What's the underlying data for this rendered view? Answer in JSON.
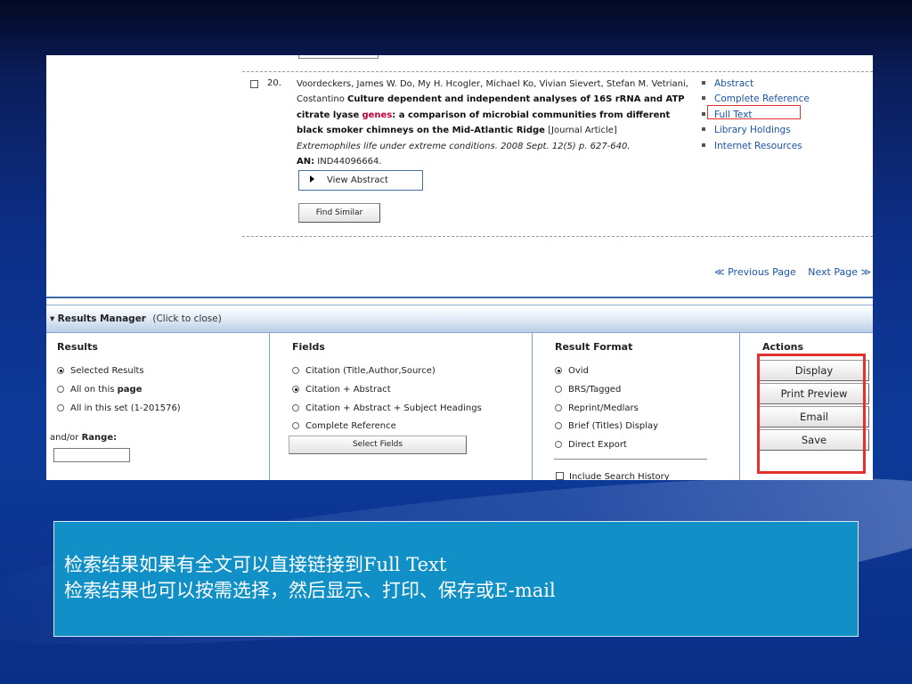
{
  "record": {
    "number": "20.",
    "authors": "Voordeckers, James W. Do, My H. Hcogler, Michael Ko, Vivian Sievert, Stefan M. Vetriani, Costantino",
    "title_part1": "Culture dependent and independent analyses of 16S rRNA and ATP citrate lyase",
    "title_highlight": "genes",
    "title_part2": ": a comparison of microbial communities from different black smoker chimneys on the Mid-Atlantic Ridge",
    "doc_type": "[Journal Article]",
    "source": "Extremophiles life under extreme conditions. 2008 Sept. 12(5) p. 627-640.",
    "an_label": "AN:",
    "an_value": "IND44096664.",
    "view_abstract_label": "View Abstract",
    "find_similar_label": "Find Similar",
    "links": [
      "Abstract",
      "Complete Reference",
      "Full Text",
      "Library Holdings",
      "Internet Resources"
    ]
  },
  "pager": {
    "previous": "≪ Previous Page",
    "next": "Next Page ≫"
  },
  "results_manager": {
    "title": "Results Manager",
    "hint": "(Click to close)",
    "results": {
      "heading": "Results",
      "opt_selected": "Selected Results",
      "opt_page_prefix": "All on this ",
      "opt_page_bold": "page",
      "opt_all": "All in this set (1-201576)",
      "range_prefix": "and/or ",
      "range_bold": "Range:"
    },
    "fields": {
      "heading": "Fields",
      "options": [
        "Citation (Title,Author,Source)",
        "Citation + Abstract",
        "Citation + Abstract + Subject Headings",
        "Complete Reference"
      ],
      "selected_index": 1,
      "select_fields_label": "Select Fields"
    },
    "format": {
      "heading": "Result Format",
      "options": [
        "Ovid",
        "BRS/Tagged",
        "Reprint/Medlars",
        "Brief (Titles) Display",
        "Direct Export"
      ],
      "selected_index": 0,
      "include_history": "Include Search History"
    },
    "actions": {
      "heading": "Actions",
      "display": "Display",
      "print_preview": "Print Preview",
      "email": "Email",
      "save": "Save"
    }
  },
  "caption": {
    "line1": "检索结果如果有全文可以直接链接到Full Text",
    "line2": "检索结果也可以按需选择，然后显示、打印、保存或E-mail"
  },
  "colors": {
    "highlight_box": "#e53030",
    "link": "#1a55a6",
    "caption_bg": "#1090c6"
  }
}
